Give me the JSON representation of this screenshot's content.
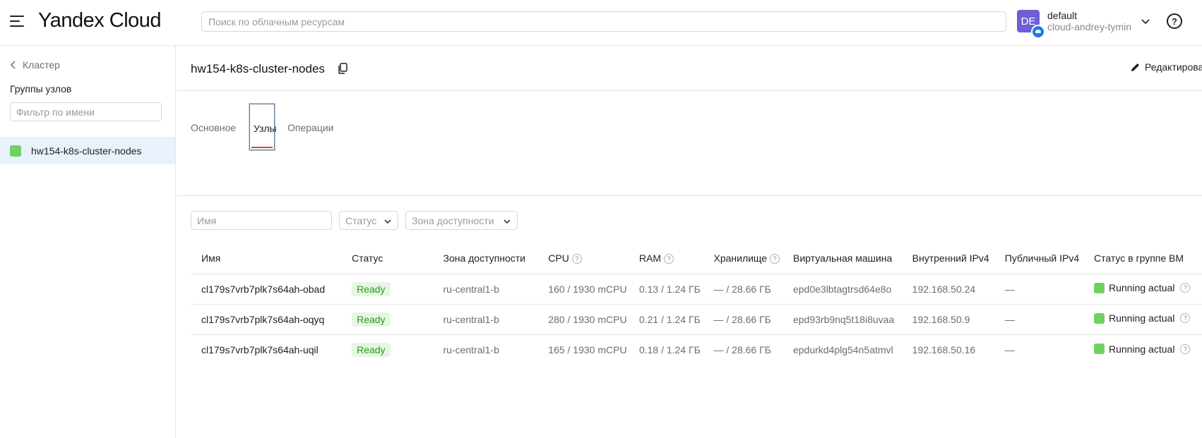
{
  "header": {
    "logo": "Yandex Cloud",
    "search_placeholder": "Поиск по облачным ресурсам",
    "avatar_initials": "DE",
    "account_name": "default",
    "cloud_name": "cloud-andrey-tymin",
    "help_glyph": "?"
  },
  "sidebar": {
    "back_label": "Кластер",
    "title": "Группы узлов",
    "filter_placeholder": "Фильтр по имени",
    "items": [
      {
        "label": "hw154-k8s-cluster-nodes",
        "status_color": "#6fd15f"
      }
    ]
  },
  "main": {
    "title": "hw154-k8s-cluster-nodes",
    "edit_label": "Редактировать",
    "tabs": [
      {
        "label": "Основное",
        "active": false
      },
      {
        "label": "Узлы",
        "active": true
      },
      {
        "label": "Операции",
        "active": false
      }
    ],
    "filters": {
      "name_placeholder": "Имя",
      "status_label": "Статус",
      "zone_label": "Зона доступности"
    },
    "table": {
      "columns": [
        "Имя",
        "Статус",
        "Зона доступности",
        "CPU",
        "RAM",
        "Хранилище",
        "Виртуальная машина",
        "Внутренний IPv4",
        "Публичный IPv4",
        "Статус в группе ВМ"
      ],
      "rows": [
        {
          "name": "cl179s7vrb7plk7s64ah-obad",
          "status": "Ready",
          "zone": "ru-central1-b",
          "cpu": "160 / 1930 mCPU",
          "ram": "0.13 / 1.24 ГБ",
          "storage": "— / 28.66 ГБ",
          "vm": "epd0e3lbtagtrsd64e8o",
          "internal_ip": "192.168.50.24",
          "public_ip": "—",
          "vm_status": "Running actual"
        },
        {
          "name": "cl179s7vrb7plk7s64ah-oqyq",
          "status": "Ready",
          "zone": "ru-central1-b",
          "cpu": "280 / 1930 mCPU",
          "ram": "0.21 / 1.24 ГБ",
          "storage": "— / 28.66 ГБ",
          "vm": "epd93rb9nq5t18i8uvaa",
          "internal_ip": "192.168.50.9",
          "public_ip": "—",
          "vm_status": "Running actual"
        },
        {
          "name": "cl179s7vrb7plk7s64ah-uqil",
          "status": "Ready",
          "zone": "ru-central1-b",
          "cpu": "165 / 1930 mCPU",
          "ram": "0.18 / 1.24 ГБ",
          "storage": "— / 28.66 ГБ",
          "vm": "epdurkd4plg54n5atmvl",
          "internal_ip": "192.168.50.16",
          "public_ip": "—",
          "vm_status": "Running actual"
        }
      ]
    }
  },
  "colors": {
    "accent_blue": "#1f7ae6",
    "avatar": "#6e5fd6",
    "ok_green": "#6fd15f",
    "tab_underline": "#e0433a"
  },
  "icons": {
    "menu": "burger-menu-icon",
    "account_chevron": "chevron-down-icon",
    "help": "help-circle-icon",
    "copy": "copy-icon",
    "edit": "pencil-icon",
    "back": "chevron-left-icon"
  }
}
